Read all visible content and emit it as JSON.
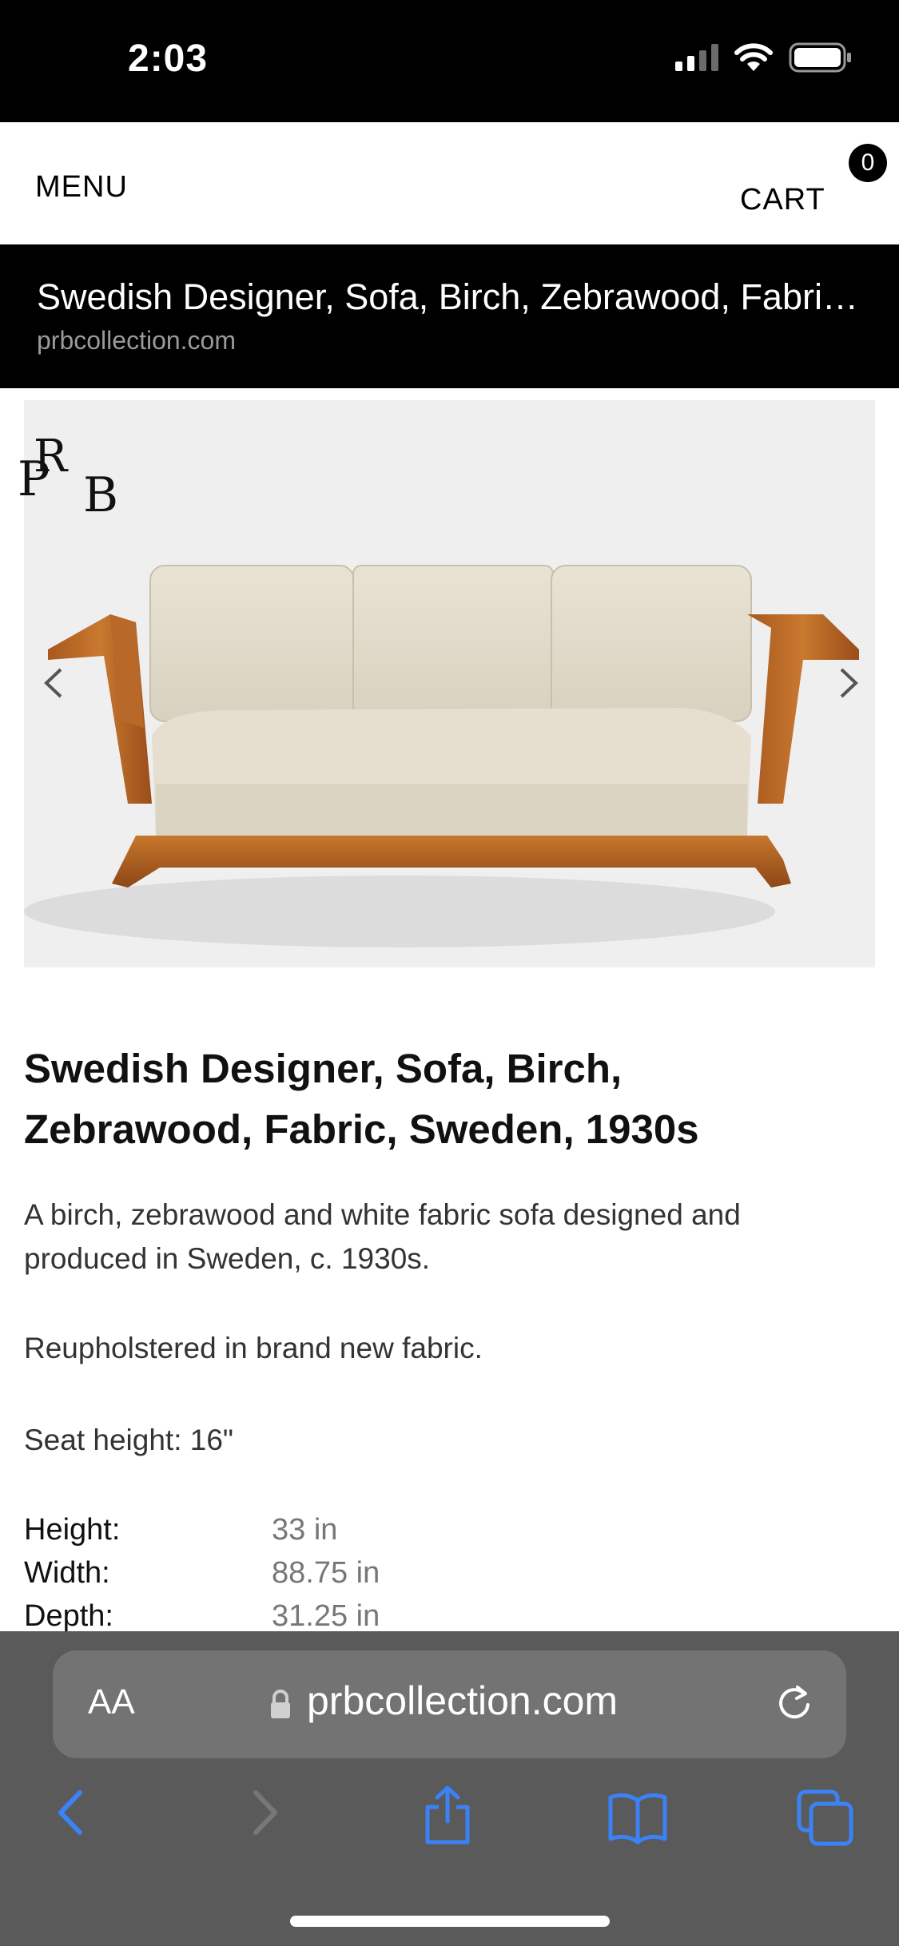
{
  "status_bar": {
    "time": "2:03"
  },
  "header": {
    "menu_label": "MENU",
    "cart_label": "CART",
    "cart_count": "0"
  },
  "banner": {
    "title": "Swedish Designer, Sofa, Birch, Zebrawood, Fabric, Sweden, 1930s",
    "domain": "prbcollection.com"
  },
  "brand": {
    "logo_text": "PRB"
  },
  "product": {
    "title": "Swedish Designer, Sofa, Birch, Zebrawood, Fabric, Sweden, 1930s",
    "description": "A birch, zebrawood and white fabric sofa designed and produced in Sweden, c. 1930s.",
    "note": "Reupholstered in brand new fabric.",
    "seat_height": "Seat height: 16\"",
    "dimensions": [
      {
        "label": "Height:",
        "value": "33 in"
      },
      {
        "label": "Width:",
        "value": "88.75 in"
      },
      {
        "label": "Depth:",
        "value": "31.25 in"
      }
    ]
  },
  "browser": {
    "text_size_label": "AA",
    "url": "prbcollection.com",
    "icons": [
      "back-icon",
      "forward-icon",
      "share-icon",
      "bookmarks-icon",
      "tabs-icon",
      "reload-icon",
      "lock-icon"
    ]
  },
  "colors": {
    "accent": "#3b82f6",
    "banner_bg": "#000000",
    "toolbar_bg": "#5a5a5a"
  }
}
